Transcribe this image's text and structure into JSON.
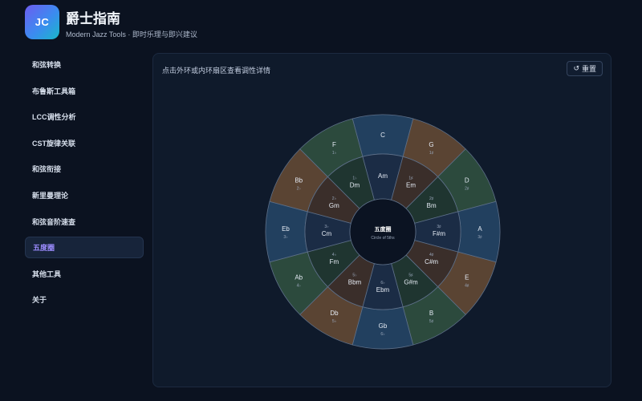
{
  "header": {
    "logo_text": "JC",
    "title": "爵士指南",
    "subtitle": "Modern Jazz Tools · 即时乐理与即兴建议"
  },
  "sidebar": {
    "items": [
      {
        "label": "和弦转换",
        "active": false
      },
      {
        "label": "布鲁斯工具箱",
        "active": false
      },
      {
        "label": "LCC调性分析",
        "active": false
      },
      {
        "label": "CST旋律关联",
        "active": false
      },
      {
        "label": "和弦衔接",
        "active": false
      },
      {
        "label": "新里曼理论",
        "active": false
      },
      {
        "label": "和弦音阶速查",
        "active": false
      },
      {
        "label": "五度圈",
        "active": true
      },
      {
        "label": "其他工具",
        "active": false
      },
      {
        "label": "关于",
        "active": false
      }
    ]
  },
  "panel": {
    "hint": "点击外环或内环扇区查看调性详情",
    "reset_label": "重置",
    "reset_icon": "↺"
  },
  "circle": {
    "center_title": "五度圈",
    "center_subtitle": "Circle of 5ths",
    "major": [
      {
        "key": "C",
        "sig": "",
        "tone": "blue"
      },
      {
        "key": "G",
        "sig": "1♯",
        "tone": "brown"
      },
      {
        "key": "D",
        "sig": "2♯",
        "tone": "green"
      },
      {
        "key": "A",
        "sig": "3♯",
        "tone": "blue"
      },
      {
        "key": "E",
        "sig": "4♯",
        "tone": "brown"
      },
      {
        "key": "B",
        "sig": "5♯",
        "tone": "green"
      },
      {
        "key": "Gb",
        "sig": "6♭",
        "tone": "blue"
      },
      {
        "key": "Db",
        "sig": "5♭",
        "tone": "brown"
      },
      {
        "key": "Ab",
        "sig": "4♭",
        "tone": "green"
      },
      {
        "key": "Eb",
        "sig": "3♭",
        "tone": "blue"
      },
      {
        "key": "Bb",
        "sig": "2♭",
        "tone": "brown"
      },
      {
        "key": "F",
        "sig": "1♭",
        "tone": "green"
      }
    ],
    "minor": [
      {
        "key": "Am",
        "sig": "",
        "tone": "blue"
      },
      {
        "key": "Em",
        "sig": "1♯",
        "tone": "brown"
      },
      {
        "key": "Bm",
        "sig": "2♯",
        "tone": "green"
      },
      {
        "key": "F#m",
        "sig": "3♯",
        "tone": "blue"
      },
      {
        "key": "C#m",
        "sig": "4♯",
        "tone": "brown"
      },
      {
        "key": "G#m",
        "sig": "5♯",
        "tone": "green"
      },
      {
        "key": "Ebm",
        "sig": "6♭",
        "tone": "blue"
      },
      {
        "key": "Bbm",
        "sig": "5♭",
        "tone": "brown"
      },
      {
        "key": "Fm",
        "sig": "4♭",
        "tone": "green"
      },
      {
        "key": "Cm",
        "sig": "3♭",
        "tone": "blue"
      },
      {
        "key": "Gm",
        "sig": "2♭",
        "tone": "brown"
      },
      {
        "key": "Dm",
        "sig": "1♭",
        "tone": "green"
      }
    ],
    "colors": {
      "outer": {
        "blue": "#22405f",
        "brown": "#5a4433",
        "green": "#2c4a3d"
      },
      "inner": {
        "blue": "#1b2c45",
        "brown": "#3a2e2a",
        "green": "#1f3530"
      },
      "stroke": "#5d6f88",
      "center": "#0b1322"
    }
  }
}
